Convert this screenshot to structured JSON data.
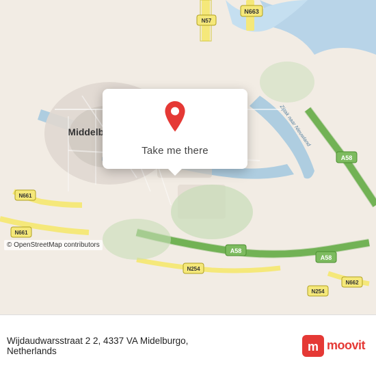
{
  "map": {
    "alt": "Map of Middelburg, Netherlands area"
  },
  "popup": {
    "button_label": "Take me there",
    "pin_color": "#e53935"
  },
  "bottom_bar": {
    "address_line": "Wijdaudwarsstraat 2 2, 4337 VA Midelburgo,",
    "country_line": "Netherlands",
    "moovit_text": "moovit",
    "copyright": "© OpenStreetMap contributors"
  }
}
